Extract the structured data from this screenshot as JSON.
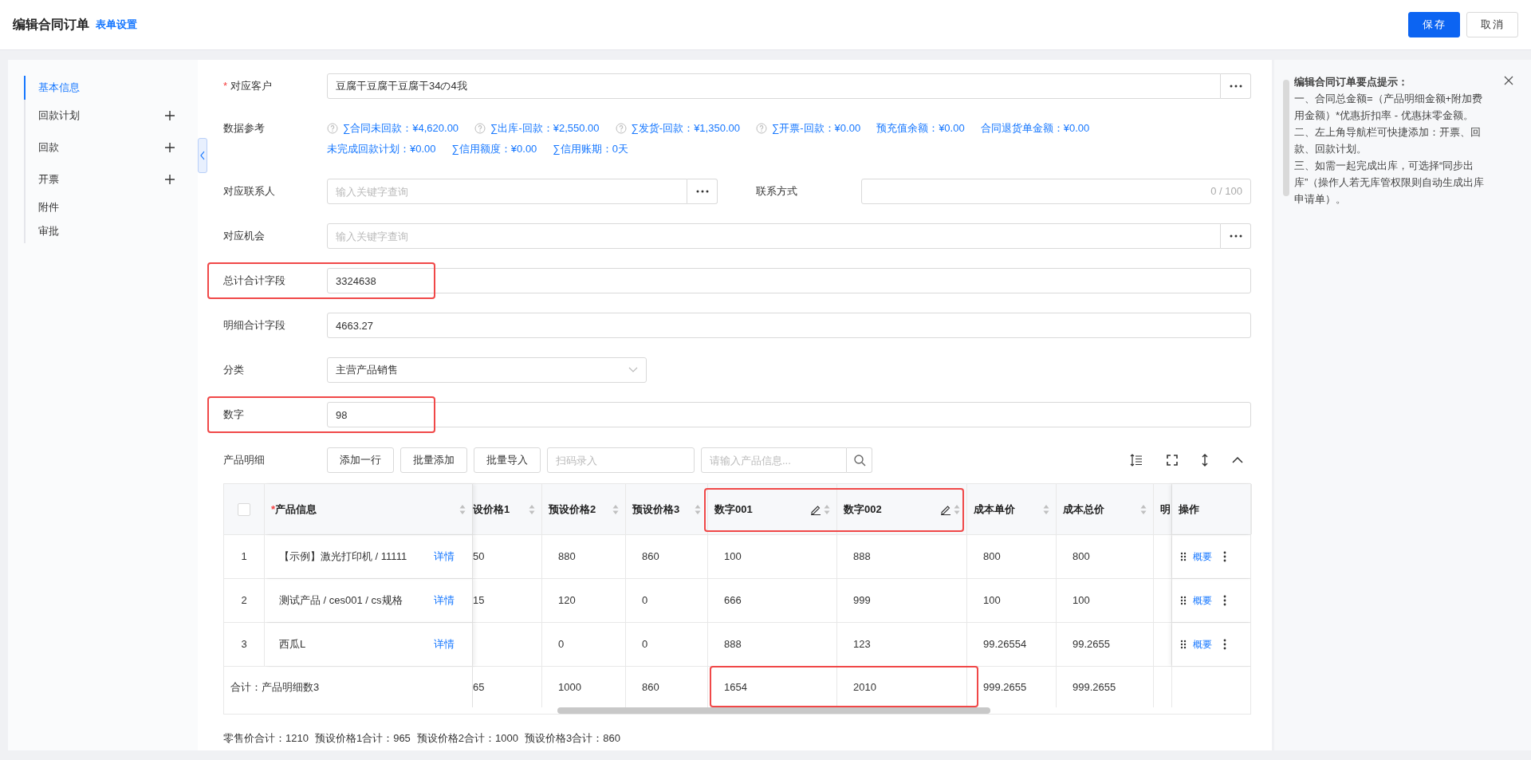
{
  "header": {
    "title": "编辑合同订单",
    "link": "表单设置",
    "buttons": [
      {
        "label": "保存",
        "kind": "primary"
      },
      {
        "label": "取消",
        "kind": "default"
      }
    ]
  },
  "sidebar": {
    "items": [
      {
        "label": "基本信息",
        "selected": true,
        "addable": false
      },
      {
        "label": "回款计划",
        "selected": false,
        "addable": true
      },
      {
        "label": "回款",
        "selected": false,
        "addable": true
      },
      {
        "label": "开票",
        "selected": false,
        "addable": true
      },
      {
        "label": "附件",
        "selected": false,
        "addable": false
      },
      {
        "label": "审批",
        "selected": false,
        "addable": false
      }
    ]
  },
  "form": {
    "fields": [
      {
        "kind": "lookup",
        "required_mark": "*",
        "label": "对应客户",
        "highlighted": false,
        "value": "豆腐干豆腐干豆腐干34の4我"
      },
      {
        "kind": "reference",
        "label": "数据参考",
        "highlighted": false,
        "lines": [
          [
            {
              "text": "∑合同未回款：¥4,620.00",
              "help": true
            },
            {
              "text": "∑出库-回款：¥2,550.00",
              "help": true
            },
            {
              "text": "∑发货-回款：¥1,350.00",
              "help": true
            },
            {
              "text": "∑开票-回款：¥0.00",
              "help": true
            },
            {
              "text": "预充值余额：¥0.00",
              "help": false
            },
            {
              "text": "合同退货单金额：¥0.00",
              "help": false
            }
          ],
          [
            {
              "text": "未完成回款计划：¥0.00",
              "help": false
            },
            {
              "text": "∑信用额度：¥0.00",
              "help": false
            },
            {
              "text": "∑信用账期：0天",
              "help": false
            }
          ]
        ]
      },
      {
        "kind": "pair",
        "label": "对应联系人",
        "highlighted": false,
        "placeholder": "输入关键字查询",
        "second_label": "联系方式",
        "counter": "0 / 100"
      },
      {
        "kind": "lookup",
        "label": "对应机会",
        "highlighted": false,
        "placeholder": "输入关键字查询"
      },
      {
        "kind": "text",
        "label": "总计合计字段",
        "highlighted": true,
        "value": "3324638"
      },
      {
        "kind": "text",
        "label": "明细合计字段",
        "highlighted": false,
        "value": "4663.27"
      },
      {
        "kind": "select",
        "label": "分类",
        "highlighted": false,
        "value": "主营产品销售"
      },
      {
        "kind": "text",
        "label": "数字",
        "highlighted": true,
        "value": "98"
      }
    ]
  },
  "products": {
    "label": "产品明细",
    "buttons": [
      "添加一行",
      "批量添加",
      "批量导入"
    ],
    "scan_placeholder": "扫码录入",
    "search_placeholder": "请输入产品信息...",
    "table": {
      "columns": [
        {
          "kind": "checkbox",
          "checked": false
        },
        {
          "kind": "product",
          "required_mark": "*",
          "label": "产品信息",
          "sortable": true,
          "editable": false,
          "highlighted": false
        },
        {
          "kind": "value",
          "label": "设价格1",
          "sortable": true,
          "editable": false,
          "highlighted": false
        },
        {
          "kind": "value",
          "label": "预设价格2",
          "sortable": true,
          "editable": false,
          "highlighted": false
        },
        {
          "kind": "value",
          "label": "预设价格3",
          "sortable": true,
          "editable": false,
          "highlighted": false
        },
        {
          "kind": "value",
          "label": "数字001",
          "sortable": true,
          "editable": true,
          "highlighted": true
        },
        {
          "kind": "value",
          "label": "数字002",
          "sortable": true,
          "editable": true,
          "highlighted": true
        },
        {
          "kind": "value",
          "label": "成本单价",
          "sortable": true,
          "editable": false,
          "highlighted": false
        },
        {
          "kind": "value",
          "label": "成本总价",
          "sortable": true,
          "editable": false,
          "highlighted": false
        },
        {
          "kind": "value",
          "label": "明",
          "sortable": false,
          "editable": false,
          "highlighted": false
        },
        {
          "kind": "actions",
          "label": "操作",
          "sortable": false,
          "editable": false,
          "highlighted": false
        }
      ],
      "rows": [
        {
          "cells": [
            "1",
            "【示例】激光打印机 / 11111",
            "50",
            "880",
            "860",
            "100",
            "888",
            "800",
            "800"
          ],
          "detail": "详情",
          "action": "概要"
        },
        {
          "cells": [
            "2",
            "测试产品 / ces001 / cs规格",
            "15",
            "120",
            "0",
            "666",
            "999",
            "100",
            "100"
          ],
          "detail": "详情",
          "action": "概要"
        },
        {
          "cells": [
            "3",
            "西瓜L",
            null,
            "0",
            "0",
            "888",
            "123",
            "99.26554",
            "99.2655"
          ],
          "detail": "详情",
          "action": "概要"
        }
      ],
      "total": {
        "label": "合计：产品明细数3",
        "cells": [
          "65",
          "1000",
          "860",
          "1654",
          "2010",
          "999.2655",
          "999.2655"
        ]
      }
    },
    "summary": [
      "零售价合计：1210",
      "预设价格1合计：965",
      "预设价格2合计：1000",
      "预设价格3合计：860"
    ]
  },
  "tips": {
    "title": "编辑合同订单要点提示：",
    "lines": [
      "一、合同总金额=（产品明细金额+附加费用金额）*优惠折扣率 - 优惠抹零金额。",
      "二、左上角导航栏可快捷添加：开票、回款、回款计划。",
      "三、如需一起完成出库，可选择“同步出库”（操作人若无库管权限则自动生成出库申请单）。"
    ]
  }
}
